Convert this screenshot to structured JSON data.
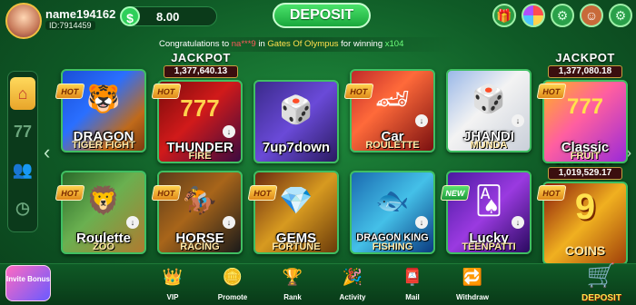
{
  "user": {
    "name": "name194162",
    "id": "ID:7914459"
  },
  "wallet": {
    "currency_icon": "dollar-icon",
    "balance": "8.00"
  },
  "header": {
    "deposit_label": "DEPOSIT"
  },
  "marquee": {
    "prefix": "Congratulations to ",
    "user": "na***9",
    "mid": " in ",
    "game": "Gates Of Olympus",
    "suffix": " for winning ",
    "amount": "x104"
  },
  "jackpots": [
    {
      "title": "JACKPOT",
      "value": "1,377,640.13"
    },
    {
      "title": "JACKPOT",
      "value": "1,377,080.18"
    },
    {
      "title": "JACKPOT",
      "value": "1,019,529.17"
    }
  ],
  "games": [
    {
      "name": "DRAGON",
      "sub": "TIGER FIGHT",
      "badge": "HOT"
    },
    {
      "name": "THUNDER",
      "sub": "FIRE",
      "badge": "HOT"
    },
    {
      "name": "7up7down",
      "sub": "",
      "badge": ""
    },
    {
      "name": "Car",
      "sub": "ROULETTE",
      "badge": "HOT"
    },
    {
      "name": "JHANDI",
      "sub": "MUNDA",
      "badge": ""
    },
    {
      "name": "Classic",
      "sub": "FRUIT",
      "badge": "HOT"
    },
    {
      "name": "Roulette",
      "sub": "ZOO",
      "badge": "HOT"
    },
    {
      "name": "HORSE",
      "sub": "RACING",
      "badge": "HOT"
    },
    {
      "name": "GEMS",
      "sub": "FORTUNE",
      "badge": "HOT"
    },
    {
      "name": "DRAGON KING",
      "sub": "FISHING",
      "badge": ""
    },
    {
      "name": "Lucky",
      "sub": "TEENPATTI",
      "badge": "NEW"
    },
    {
      "name": "9",
      "sub": "COINS",
      "badge": "HOT"
    }
  ],
  "nav": {
    "invite": "Invite Bonus",
    "vip": "VIP",
    "promote": "Promote",
    "rank": "Rank",
    "activity": "Activity",
    "mail": "Mail",
    "withdraw": "Withdraw",
    "deposit": "DEPOSIT"
  },
  "colors": {
    "accent": "#3fbf62",
    "background": "#0f5a26",
    "gold": "#ffd24d"
  }
}
